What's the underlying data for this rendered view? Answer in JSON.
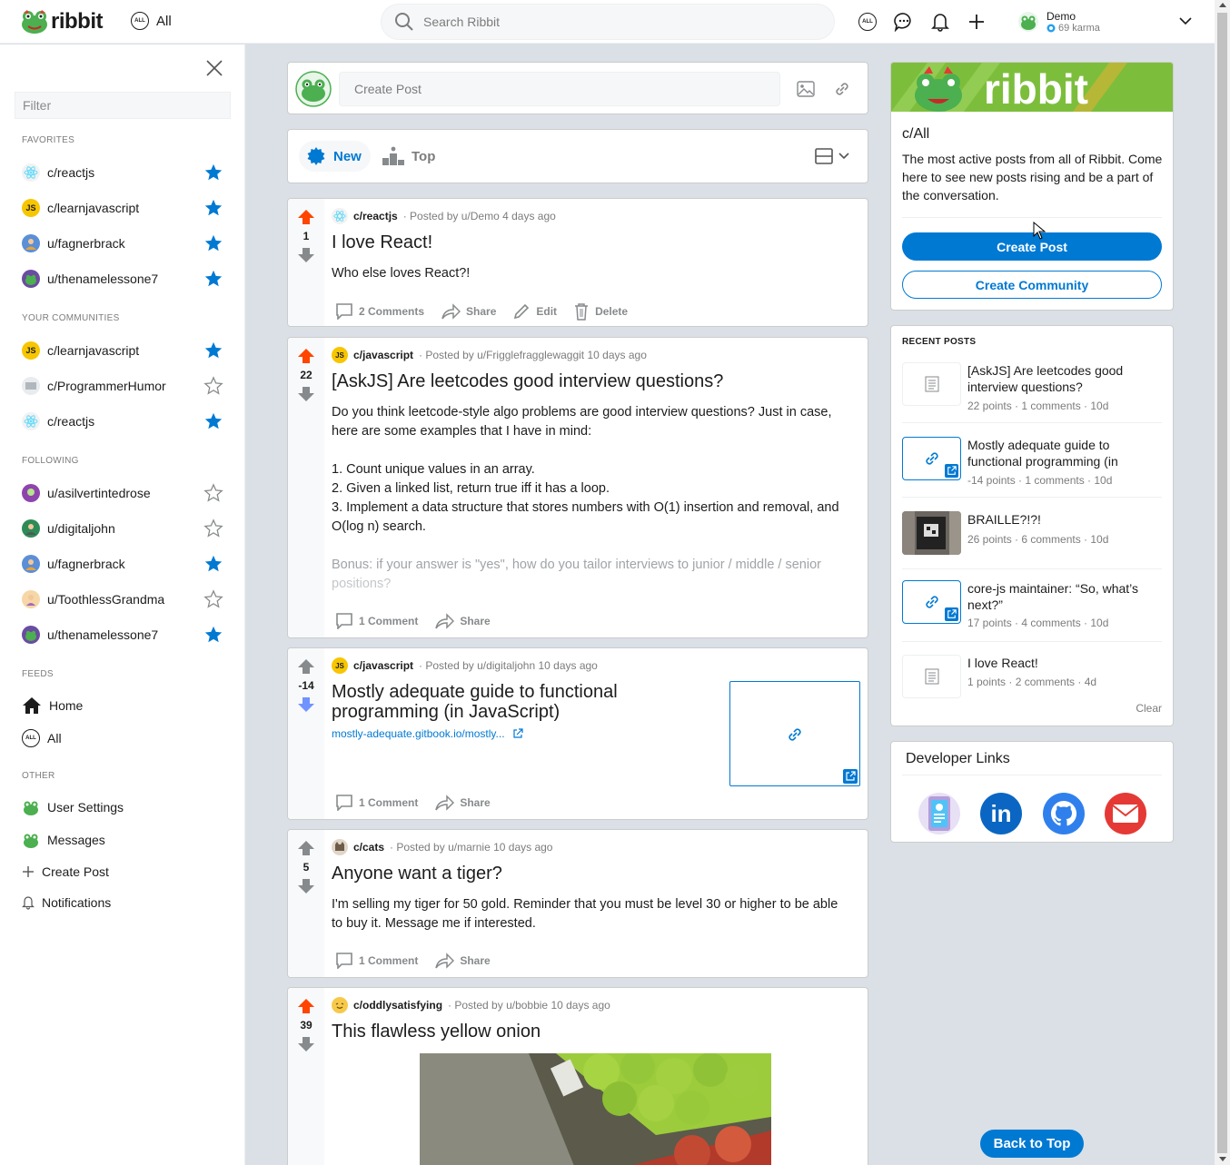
{
  "header": {
    "logo_text": "ribbit",
    "feed_label": "All",
    "feed_badge": "ALL",
    "search_placeholder": "Search Ribbit",
    "user_name": "Demo",
    "karma": "69 karma"
  },
  "sidebar": {
    "filter_placeholder": "Filter",
    "sections": {
      "favorites": "FAVORITES",
      "communities": "YOUR COMMUNITIES",
      "following": "FOLLOWING",
      "feeds": "FEEDS",
      "other": "OTHER"
    },
    "favorites": [
      {
        "label": "c/reactjs",
        "starred": true
      },
      {
        "label": "c/learnjavascript",
        "starred": true
      },
      {
        "label": "u/fagnerbrack",
        "starred": true
      },
      {
        "label": "u/thenamelessone7",
        "starred": true
      }
    ],
    "communities": [
      {
        "label": "c/learnjavascript",
        "starred": true
      },
      {
        "label": "c/ProgrammerHumor",
        "starred": false
      },
      {
        "label": "c/reactjs",
        "starred": true
      }
    ],
    "following": [
      {
        "label": "u/asilvertintedrose",
        "starred": false
      },
      {
        "label": "u/digitaljohn",
        "starred": false
      },
      {
        "label": "u/fagnerbrack",
        "starred": true
      },
      {
        "label": "u/ToothlessGrandma",
        "starred": false
      },
      {
        "label": "u/thenamelessone7",
        "starred": true
      }
    ],
    "feeds": [
      {
        "label": "Home"
      },
      {
        "label": "All",
        "badge": "ALL"
      }
    ],
    "other": [
      {
        "label": "User Settings"
      },
      {
        "label": "Messages"
      },
      {
        "label": "Create Post"
      },
      {
        "label": "Notifications"
      }
    ]
  },
  "create_post": {
    "placeholder": "Create Post"
  },
  "sort": {
    "new_label": "New",
    "top_label": "Top"
  },
  "posts": [
    {
      "score": "1",
      "sub": "c/reactjs",
      "posted_by": "· Posted by u/Demo 4 days ago",
      "title": "I love React!",
      "body": "Who else loves React?!",
      "comments": "2 Comments",
      "share": "Share",
      "edit": "Edit",
      "delete": "Delete"
    },
    {
      "score": "22",
      "sub": "c/javascript",
      "sub_badge": "JS",
      "posted_by": "· Posted by u/Frigglefragglewaggit 10 days ago",
      "title": "[AskJS] Are leetcodes good interview questions?",
      "body_lines": [
        "Do you think leetcode-style algo problems are good interview questions? Just in case,",
        "here are some examples that I have in mind:",
        "",
        "1. Count unique values in an array.",
        "2. Given a linked list, return true iff it has a loop.",
        "3. Implement a data structure that stores numbers with O(1) insertion and removal, and",
        "O(log n) search.",
        "",
        "Bonus: if your answer is \"yes\", how do you tailor interviews to junior / middle / senior",
        "positions?"
      ],
      "comments": "1 Comment",
      "share": "Share"
    },
    {
      "score": "-14",
      "sub": "c/javascript",
      "sub_badge": "JS",
      "posted_by": "· Posted by u/digitaljohn 10 days ago",
      "title_line1": "Mostly adequate guide to functional",
      "title_line2": "programming (in JavaScript)",
      "link": "mostly-adequate.gitbook.io/mostly...",
      "comments": "1 Comment",
      "share": "Share"
    },
    {
      "score": "5",
      "sub": "c/cats",
      "posted_by": "· Posted by u/marnie 10 days ago",
      "title": "Anyone want a tiger?",
      "body_line1": "I'm selling my tiger for 50 gold. Reminder that you must be level 30 or higher to be able",
      "body_line2": "to buy it. Message me if interested.",
      "comments": "1 Comment",
      "share": "Share"
    },
    {
      "score": "39",
      "sub": "c/oddlysatisfying",
      "posted_by": "· Posted by u/bobbie 10 days ago",
      "title": "This flawless yellow onion"
    }
  ],
  "about": {
    "banner_text": "ribbit",
    "title": "c/All",
    "description": "The most active posts from all of Ribbit. Come here to see new posts rising and be a part of the conversation.",
    "create_post": "Create Post",
    "create_community": "Create Community"
  },
  "recent": {
    "heading": "RECENT POSTS",
    "items": [
      {
        "title": "[AskJS] Are leetcodes good interview questions?",
        "meta": "22 points · 1 comments · 10d",
        "thumb": "text"
      },
      {
        "title": "Mostly adequate guide to functional programming (in",
        "meta": "-14 points · 1 comments · 10d",
        "thumb": "link"
      },
      {
        "title": "BRAILLE?!?!",
        "meta": "26 points · 6 comments · 10d",
        "thumb": "image"
      },
      {
        "title": "core-js maintainer: “So, what’s next?”",
        "meta": "17 points · 4 comments · 10d",
        "thumb": "link"
      },
      {
        "title": "I love React!",
        "meta": "1 points · 2 comments · 4d",
        "thumb": "text"
      }
    ],
    "clear": "Clear"
  },
  "dev_links": {
    "title": "Developer Links",
    "icons": [
      "portfolio-icon",
      "linkedin-icon",
      "github-icon",
      "email-icon"
    ],
    "linkedin_text": "in"
  },
  "back_to_top": "Back to Top",
  "colors": {
    "accent": "#0079d3",
    "upvote": "#ff4500",
    "downvote": "#7193ff",
    "star": "#0079d3",
    "brand_green": "#7cbe3c"
  }
}
